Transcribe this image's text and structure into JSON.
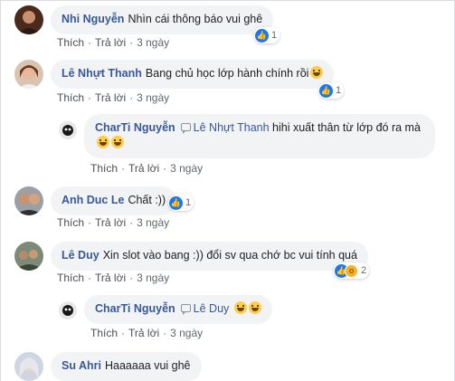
{
  "actions": {
    "like": "Thích",
    "reply": "Trả lời",
    "time": "3 ngày"
  },
  "comments": [
    {
      "author": "Nhi Nguyễn",
      "text": "Nhìn cái thông báo vui ghê",
      "reaction_count": "1"
    },
    {
      "author": "Lê Nhựt Thanh",
      "text": "Bang chủ học lớp hành chính rồi",
      "reaction_count": "1"
    },
    {
      "author": "CharTi Nguyễn",
      "tagged": "Lê Nhựt Thanh",
      "text": "hihi xuất thân từ lớp đó ra mà"
    },
    {
      "author": "Anh Duc Le",
      "text": "Chất :))",
      "reaction_count": "1"
    },
    {
      "author": "Lê Duy",
      "text": "Xin slot vào bang :)) đổi sv qua chớ bc vui tính quá",
      "reaction_count": "2"
    },
    {
      "author": "CharTi Nguyễn",
      "tagged": "Lê Duy",
      "text": ""
    },
    {
      "author": "Su Ahri",
      "text": "Haaaaaa vui ghê"
    }
  ],
  "colors": {
    "author": "#385898",
    "bubble": "#f2f3f5",
    "like": "#1877f2",
    "wow": "#f7b125"
  },
  "icons": {
    "like": "like-icon",
    "wow": "wow-icon",
    "emoji": "grin-emoji"
  }
}
